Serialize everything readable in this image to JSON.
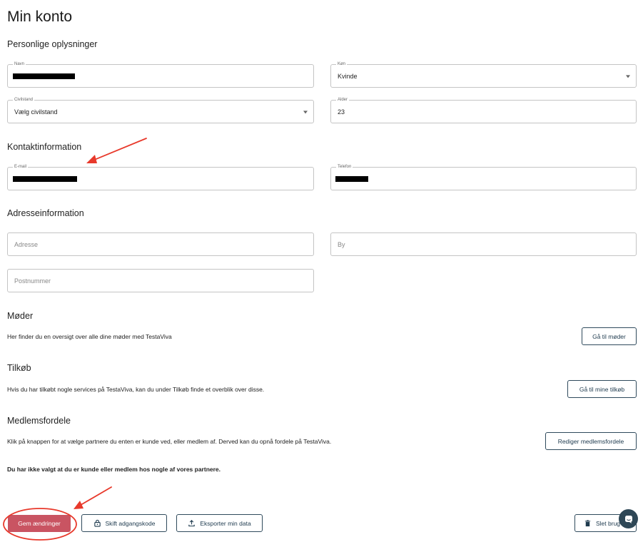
{
  "page": {
    "title": "Min konto"
  },
  "sections": {
    "personal": "Personlige oplysninger",
    "contact": "Kontaktinformation",
    "address": "Adresseinformation",
    "meetings": "Møder",
    "purchases": "Tilkøb",
    "benefits": "Medlemsfordele"
  },
  "fields": {
    "name": {
      "label": "Navn",
      "value": ""
    },
    "gender": {
      "label": "Køn",
      "value": "Kvinde"
    },
    "civil": {
      "label": "Civilstand",
      "value": "Vælg civilstand"
    },
    "age": {
      "label": "Alder",
      "value": "23"
    },
    "email": {
      "label": "E-mail",
      "value": ""
    },
    "phone": {
      "label": "Telefon",
      "value": ""
    },
    "address": {
      "placeholder": "Adresse"
    },
    "city": {
      "placeholder": "By"
    },
    "postal": {
      "placeholder": "Postnummer"
    }
  },
  "meetings": {
    "description": "Her finder du en oversigt over alle dine møder med TestaViva",
    "button": "Gå til møder"
  },
  "purchases": {
    "description": "Hvis du har tilkøbt nogle services på TestaViva, kan du under Tilkøb finde et overblik over disse.",
    "button": "Gå til mine tilkøb"
  },
  "benefits": {
    "description": "Klik på knappen for at vælge partnere du enten er kunde ved, eller medlem af. Derved kan du opnå fordele på TestaViva.",
    "button": "Rediger medlemsfordele",
    "note": "Du har ikke valgt at du er kunde eller medlem hos nogle af vores partnere."
  },
  "actions": {
    "save": "Gem ændringer",
    "change_password": "Skift adgangskode",
    "export": "Eksporter min data",
    "delete": "Slet brug"
  },
  "colors": {
    "primary": "#c95462",
    "outline": "#2f4a5c",
    "annotation": "#e8392b"
  },
  "icons": {
    "change_password": "lock-icon",
    "export": "upload-icon",
    "delete": "trash-icon",
    "chat": "chat-icon"
  }
}
